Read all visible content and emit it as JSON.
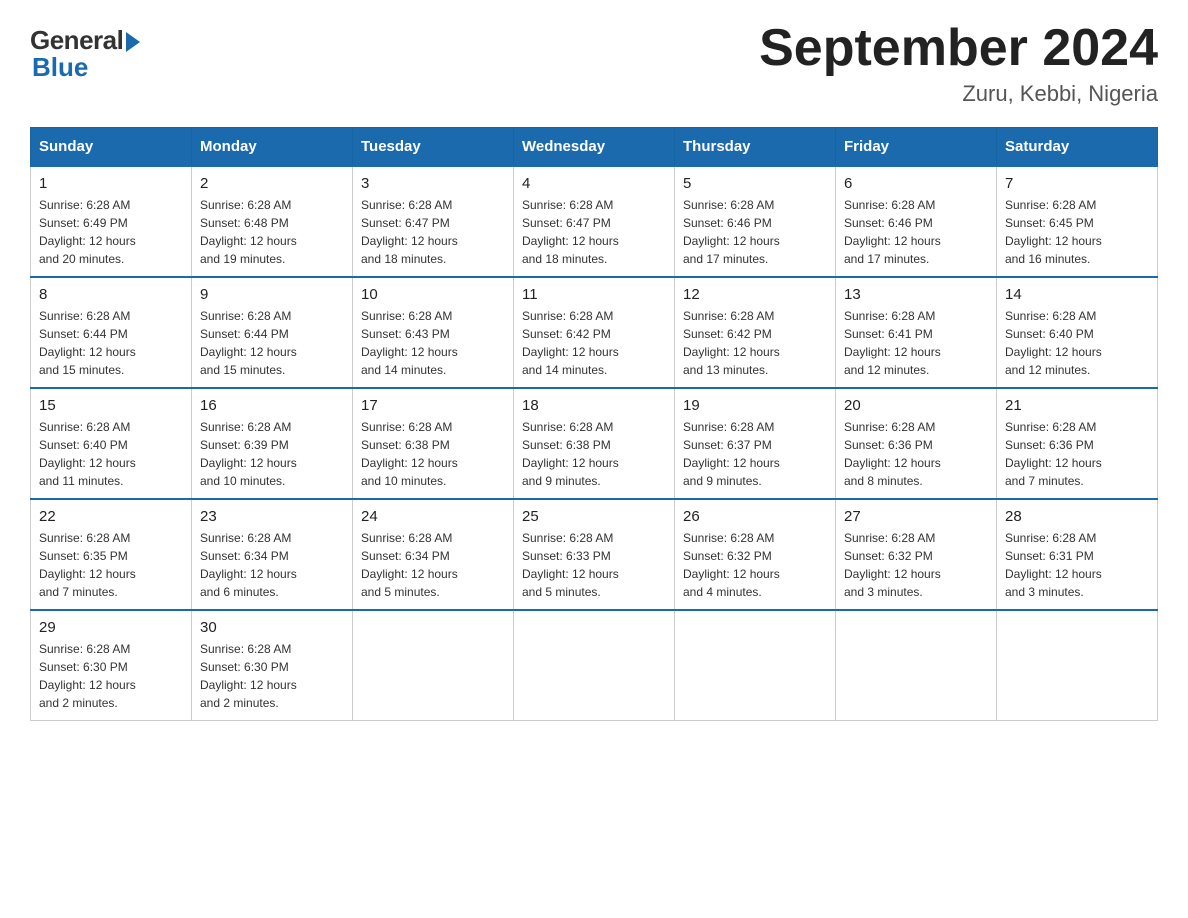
{
  "header": {
    "logo_general": "General",
    "logo_blue": "Blue",
    "title": "September 2024",
    "subtitle": "Zuru, Kebbi, Nigeria"
  },
  "days_of_week": [
    "Sunday",
    "Monday",
    "Tuesday",
    "Wednesday",
    "Thursday",
    "Friday",
    "Saturday"
  ],
  "weeks": [
    [
      {
        "day": "1",
        "sunrise": "6:28 AM",
        "sunset": "6:49 PM",
        "daylight": "12 hours and 20 minutes."
      },
      {
        "day": "2",
        "sunrise": "6:28 AM",
        "sunset": "6:48 PM",
        "daylight": "12 hours and 19 minutes."
      },
      {
        "day": "3",
        "sunrise": "6:28 AM",
        "sunset": "6:47 PM",
        "daylight": "12 hours and 18 minutes."
      },
      {
        "day": "4",
        "sunrise": "6:28 AM",
        "sunset": "6:47 PM",
        "daylight": "12 hours and 18 minutes."
      },
      {
        "day": "5",
        "sunrise": "6:28 AM",
        "sunset": "6:46 PM",
        "daylight": "12 hours and 17 minutes."
      },
      {
        "day": "6",
        "sunrise": "6:28 AM",
        "sunset": "6:46 PM",
        "daylight": "12 hours and 17 minutes."
      },
      {
        "day": "7",
        "sunrise": "6:28 AM",
        "sunset": "6:45 PM",
        "daylight": "12 hours and 16 minutes."
      }
    ],
    [
      {
        "day": "8",
        "sunrise": "6:28 AM",
        "sunset": "6:44 PM",
        "daylight": "12 hours and 15 minutes."
      },
      {
        "day": "9",
        "sunrise": "6:28 AM",
        "sunset": "6:44 PM",
        "daylight": "12 hours and 15 minutes."
      },
      {
        "day": "10",
        "sunrise": "6:28 AM",
        "sunset": "6:43 PM",
        "daylight": "12 hours and 14 minutes."
      },
      {
        "day": "11",
        "sunrise": "6:28 AM",
        "sunset": "6:42 PM",
        "daylight": "12 hours and 14 minutes."
      },
      {
        "day": "12",
        "sunrise": "6:28 AM",
        "sunset": "6:42 PM",
        "daylight": "12 hours and 13 minutes."
      },
      {
        "day": "13",
        "sunrise": "6:28 AM",
        "sunset": "6:41 PM",
        "daylight": "12 hours and 12 minutes."
      },
      {
        "day": "14",
        "sunrise": "6:28 AM",
        "sunset": "6:40 PM",
        "daylight": "12 hours and 12 minutes."
      }
    ],
    [
      {
        "day": "15",
        "sunrise": "6:28 AM",
        "sunset": "6:40 PM",
        "daylight": "12 hours and 11 minutes."
      },
      {
        "day": "16",
        "sunrise": "6:28 AM",
        "sunset": "6:39 PM",
        "daylight": "12 hours and 10 minutes."
      },
      {
        "day": "17",
        "sunrise": "6:28 AM",
        "sunset": "6:38 PM",
        "daylight": "12 hours and 10 minutes."
      },
      {
        "day": "18",
        "sunrise": "6:28 AM",
        "sunset": "6:38 PM",
        "daylight": "12 hours and 9 minutes."
      },
      {
        "day": "19",
        "sunrise": "6:28 AM",
        "sunset": "6:37 PM",
        "daylight": "12 hours and 9 minutes."
      },
      {
        "day": "20",
        "sunrise": "6:28 AM",
        "sunset": "6:36 PM",
        "daylight": "12 hours and 8 minutes."
      },
      {
        "day": "21",
        "sunrise": "6:28 AM",
        "sunset": "6:36 PM",
        "daylight": "12 hours and 7 minutes."
      }
    ],
    [
      {
        "day": "22",
        "sunrise": "6:28 AM",
        "sunset": "6:35 PM",
        "daylight": "12 hours and 7 minutes."
      },
      {
        "day": "23",
        "sunrise": "6:28 AM",
        "sunset": "6:34 PM",
        "daylight": "12 hours and 6 minutes."
      },
      {
        "day": "24",
        "sunrise": "6:28 AM",
        "sunset": "6:34 PM",
        "daylight": "12 hours and 5 minutes."
      },
      {
        "day": "25",
        "sunrise": "6:28 AM",
        "sunset": "6:33 PM",
        "daylight": "12 hours and 5 minutes."
      },
      {
        "day": "26",
        "sunrise": "6:28 AM",
        "sunset": "6:32 PM",
        "daylight": "12 hours and 4 minutes."
      },
      {
        "day": "27",
        "sunrise": "6:28 AM",
        "sunset": "6:32 PM",
        "daylight": "12 hours and 3 minutes."
      },
      {
        "day": "28",
        "sunrise": "6:28 AM",
        "sunset": "6:31 PM",
        "daylight": "12 hours and 3 minutes."
      }
    ],
    [
      {
        "day": "29",
        "sunrise": "6:28 AM",
        "sunset": "6:30 PM",
        "daylight": "12 hours and 2 minutes."
      },
      {
        "day": "30",
        "sunrise": "6:28 AM",
        "sunset": "6:30 PM",
        "daylight": "12 hours and 2 minutes."
      },
      null,
      null,
      null,
      null,
      null
    ]
  ],
  "labels": {
    "sunrise": "Sunrise:",
    "sunset": "Sunset:",
    "daylight": "Daylight:"
  }
}
